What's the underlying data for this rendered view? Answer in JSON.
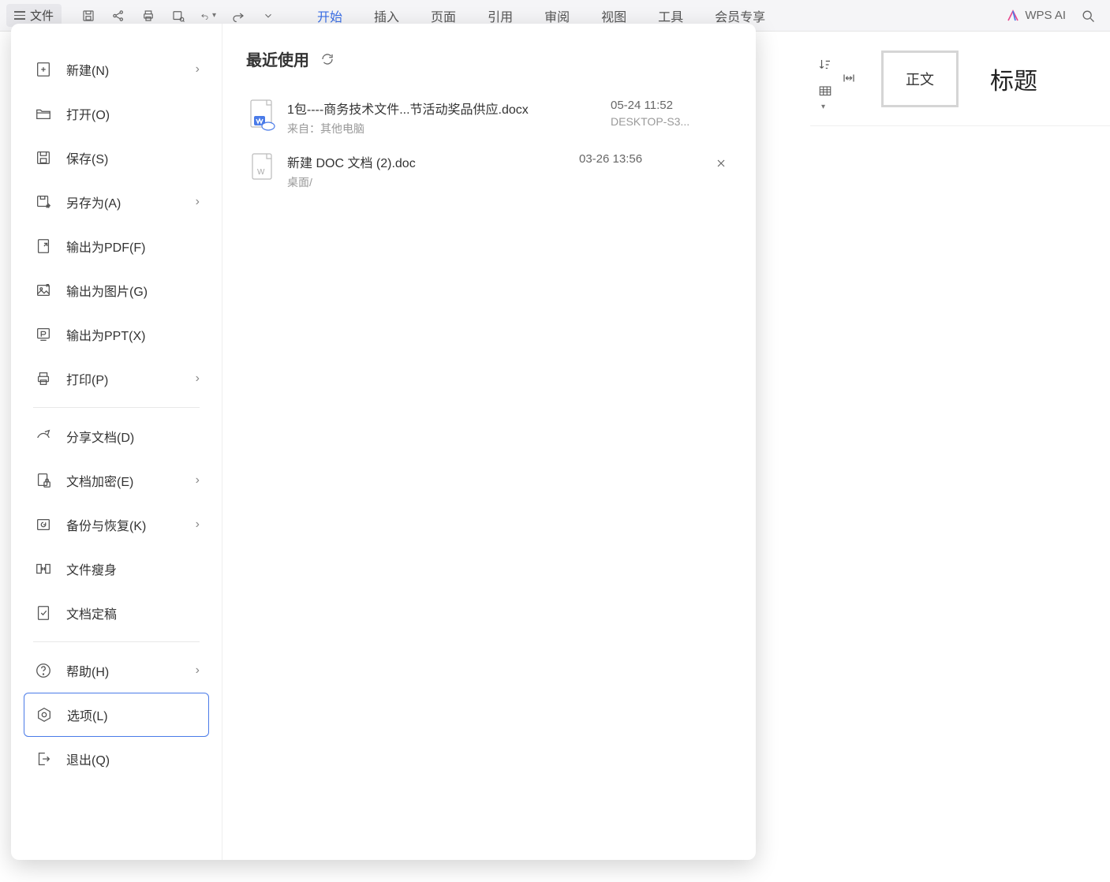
{
  "topbar": {
    "file_label": "文件",
    "tabs": [
      "开始",
      "插入",
      "页面",
      "引用",
      "审阅",
      "视图",
      "工具",
      "会员专享"
    ],
    "active_tab_index": 0,
    "wps_ai_label": "WPS AI"
  },
  "ribbon": {
    "style_box_label": "正文",
    "heading_label": "标题"
  },
  "sidebar": {
    "items": [
      {
        "label": "新建(N)",
        "has_sub": true
      },
      {
        "label": "打开(O)",
        "has_sub": false
      },
      {
        "label": "保存(S)",
        "has_sub": false
      },
      {
        "label": "另存为(A)",
        "has_sub": true
      },
      {
        "label": "输出为PDF(F)",
        "has_sub": false
      },
      {
        "label": "输出为图片(G)",
        "has_sub": false
      },
      {
        "label": "输出为PPT(X)",
        "has_sub": false
      },
      {
        "label": "打印(P)",
        "has_sub": true
      },
      {
        "label": "分享文档(D)",
        "has_sub": false
      },
      {
        "label": "文档加密(E)",
        "has_sub": true
      },
      {
        "label": "备份与恢复(K)",
        "has_sub": true
      },
      {
        "label": "文件瘦身",
        "has_sub": false
      },
      {
        "label": "文档定稿",
        "has_sub": false
      },
      {
        "label": "帮助(H)",
        "has_sub": true
      },
      {
        "label": "选项(L)",
        "has_sub": false
      },
      {
        "label": "退出(Q)",
        "has_sub": false
      }
    ],
    "selected_index": 14
  },
  "recent": {
    "title": "最近使用",
    "files": [
      {
        "name": "1包----商务技术文件...节活动奖品供应.docx",
        "meta": "来自：其他电脑",
        "time": "05-24 11:52",
        "time_sub": "DESKTOP-S3...",
        "kind": "docx-cloud"
      },
      {
        "name": "新建 DOC 文档 (2).doc",
        "meta": "桌面/",
        "time": "03-26 13:56",
        "time_sub": "",
        "kind": "doc",
        "show_close": true
      }
    ]
  }
}
